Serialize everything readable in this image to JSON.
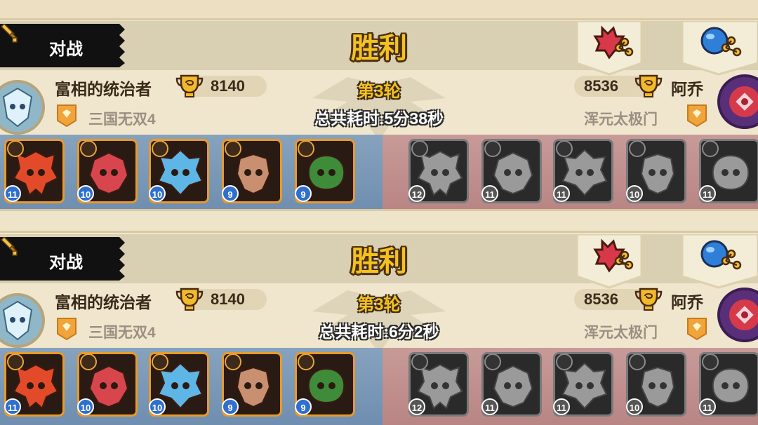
{
  "tab_label": "对战",
  "colors": {
    "accent_gold": "#f4c21f",
    "ally_lane": "#7b98b8",
    "enemy_lane": "#c08e8d",
    "header_bg": "#d9cfb3"
  },
  "battles": [
    {
      "result": "胜利",
      "round": "第3轮",
      "duration": "总共耗时:5分38秒",
      "left": {
        "name": "富相的统治者",
        "score": "8140",
        "guild": "三国无双4",
        "heroes": [
          {
            "level": "11",
            "color": "#e24a2a"
          },
          {
            "level": "10",
            "color": "#d8464d"
          },
          {
            "level": "10",
            "color": "#5db6e6"
          },
          {
            "level": "9",
            "color": "#c89070"
          },
          {
            "level": "9",
            "color": "#3e8c3a"
          }
        ]
      },
      "right": {
        "name": "阿乔",
        "score": "8536",
        "guild": "浑元太极门",
        "heroes": [
          {
            "level": "12"
          },
          {
            "level": "11"
          },
          {
            "level": "11"
          },
          {
            "level": "10"
          },
          {
            "level": "11"
          }
        ]
      }
    },
    {
      "result": "胜利",
      "round": "第3轮",
      "duration": "总共耗时:6分2秒",
      "left": {
        "name": "富相的统治者",
        "score": "8140",
        "guild": "三国无双4",
        "heroes": [
          {
            "level": "11",
            "color": "#e24a2a"
          },
          {
            "level": "10",
            "color": "#d8464d"
          },
          {
            "level": "10",
            "color": "#5db6e6"
          },
          {
            "level": "9",
            "color": "#c89070"
          },
          {
            "level": "9",
            "color": "#3e8c3a"
          }
        ]
      },
      "right": {
        "name": "阿乔",
        "score": "8536",
        "guild": "浑元太极门",
        "heroes": [
          {
            "level": "12"
          },
          {
            "level": "11"
          },
          {
            "level": "11"
          },
          {
            "level": "10"
          },
          {
            "level": "11"
          }
        ]
      }
    }
  ]
}
